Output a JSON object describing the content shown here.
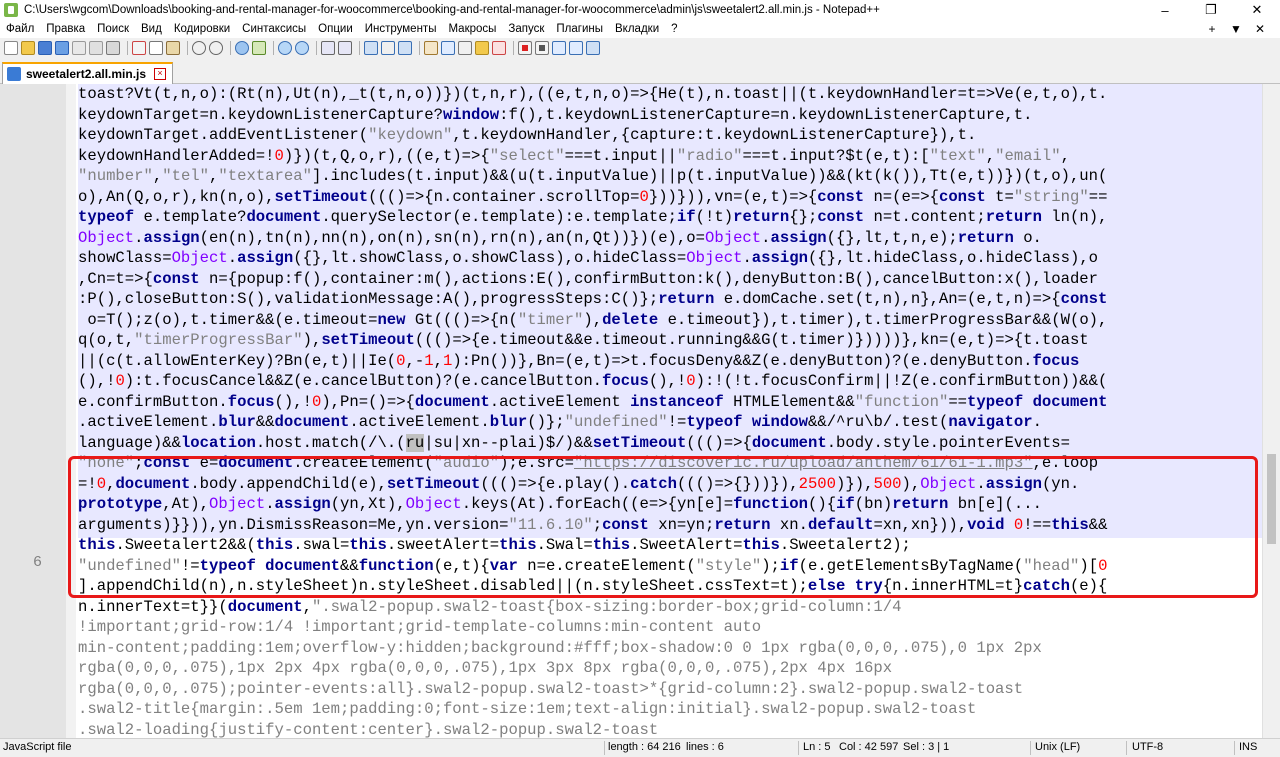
{
  "window": {
    "title": "C:\\Users\\wgcom\\Downloads\\booking-and-rental-manager-for-woocommerce\\booking-and-rental-manager-for-woocommerce\\admin\\js\\sweetalert2.all.min.js - Notepad++",
    "minimize": "–",
    "restore": "❐",
    "close": "✕"
  },
  "menu": {
    "items": [
      "Файл",
      "Правка",
      "Поиск",
      "Вид",
      "Кодировки",
      "Синтаксисы",
      "Опции",
      "Инструменты",
      "Макросы",
      "Запуск",
      "Плагины",
      "Вкладки",
      "?"
    ],
    "right": [
      "+",
      "▼",
      "✕"
    ]
  },
  "toolbar": {
    "icons": [
      "new-file-icon",
      "open-file-icon",
      "save-icon",
      "save-all-icon",
      "close-icon",
      "close-all-icon",
      "print-icon",
      "cut-icon",
      "copy-icon",
      "paste-icon",
      "undo-icon",
      "redo-icon",
      "find-icon",
      "replace-icon",
      "zoom-in-icon",
      "zoom-out-icon",
      "sync-v-icon",
      "sync-h-icon",
      "wrap-icon",
      "all-chars-icon",
      "indent-guide-icon",
      "udl-icon",
      "doc-map-icon",
      "func-list-icon",
      "folder-workspace-icon",
      "monitor-icon",
      "record-icon",
      "stop-icon",
      "play-icon",
      "play-multi-icon",
      "save-macro-icon"
    ]
  },
  "tab": {
    "label": "sweetalert2.all.min.js"
  },
  "editor": {
    "line_number": "6",
    "selected_text": "ru"
  },
  "status": {
    "file_type": "JavaScript file",
    "length": "length : 64 216",
    "lines": "lines : 6",
    "ln": "Ln : 5",
    "col": "Col : 42 597",
    "sel": "Sel : 3 | 1",
    "eol": "Unix (LF)",
    "encoding": "UTF-8",
    "ins": "INS"
  },
  "colors": {
    "keyword": "#00008b",
    "string": "#808080",
    "number": "#ff0000",
    "object": "#8000ff",
    "line_highlight": "#e8e8ff",
    "annotation_box": "#e81818",
    "tab_accent": "#f8a400"
  }
}
